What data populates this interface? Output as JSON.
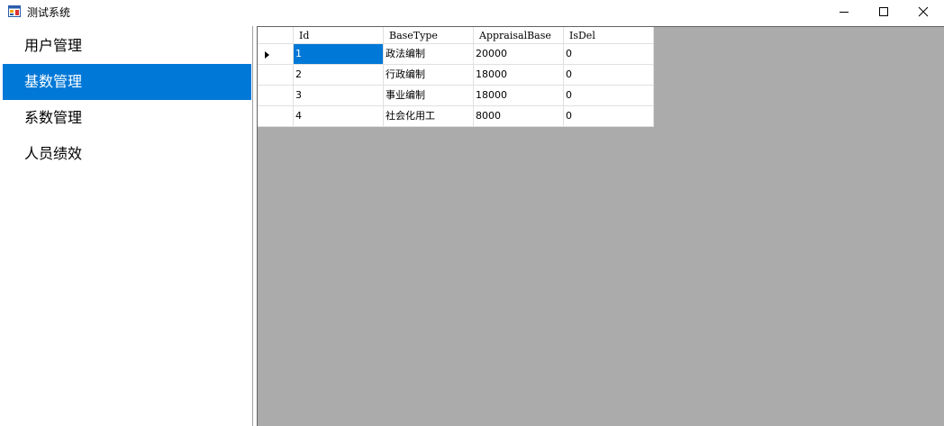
{
  "window": {
    "title": "测试系统",
    "controls": {
      "minimize_icon": "minimize-icon",
      "maximize_icon": "maximize-icon",
      "close_icon": "close-icon"
    }
  },
  "sidebar": {
    "items": [
      {
        "label": "用户管理",
        "active": false
      },
      {
        "label": "基数管理",
        "active": true
      },
      {
        "label": "系数管理",
        "active": false
      },
      {
        "label": "人员绩效",
        "active": false
      }
    ]
  },
  "grid": {
    "columns": [
      "Id",
      "BaseType",
      "AppraisalBase",
      "IsDel"
    ],
    "rows": [
      [
        "1",
        "政法编制",
        "20000",
        "0"
      ],
      [
        "2",
        "行政编制",
        "18000",
        "0"
      ],
      [
        "3",
        "事业编制",
        "18000",
        "0"
      ],
      [
        "4",
        "社会化用工",
        "8000",
        "0"
      ]
    ],
    "current_row": 0,
    "selected_cell": "row 0, column Id"
  },
  "colors": {
    "accent": "#0078d7",
    "grid_background": "#ababab"
  }
}
